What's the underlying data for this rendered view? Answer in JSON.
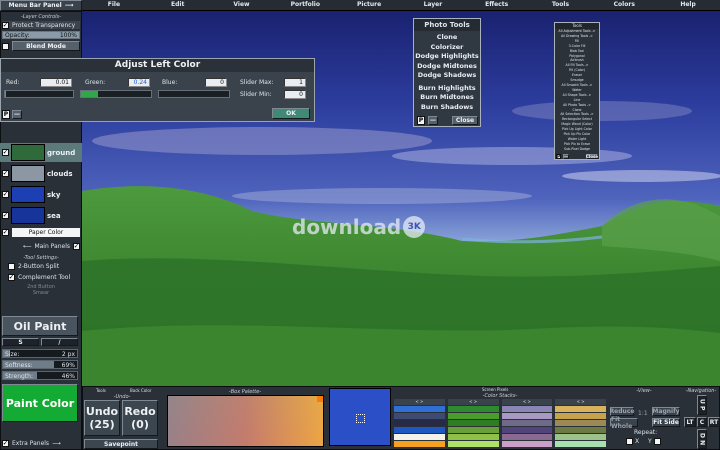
{
  "menu_bar_panel": {
    "label": "Menu Bar Panel",
    "arrow": "⟶"
  },
  "menu": {
    "items": [
      "File",
      "Edit",
      "View",
      "Portfolio",
      "Picture",
      "Layer",
      "Effects",
      "Tools",
      "Colors",
      "Help"
    ]
  },
  "layer_controls": {
    "header": "-Layer Controls-",
    "protect_label": "Protect Transparency",
    "opacity_label": "Opacity:",
    "opacity_value": "100%",
    "opacity_level": 1.0,
    "blend_label": "Blend Mode"
  },
  "adjust_color": {
    "title": "Adjust Left Color",
    "red_label": "Red:",
    "red_value": "0.01",
    "red_level": 0.01,
    "green_label": "Green:",
    "green_value": "0.24",
    "green_level": 0.24,
    "blue_label": "Blue:",
    "blue_value": "0",
    "blue_level": 0,
    "slider_max_label": "Slider Max:",
    "slider_max_value": "1",
    "slider_min_label": "Slider Min:",
    "slider_min_value": "0",
    "p_label": "P",
    "minus_label": "—",
    "ok_label": "OK"
  },
  "layers": [
    {
      "name": "ground",
      "checked": true,
      "selected": true,
      "thumb": "#2e6a3a"
    },
    {
      "name": "clouds",
      "checked": true,
      "selected": false,
      "thumb": "#8d96a3"
    },
    {
      "name": "sky",
      "checked": true,
      "selected": false,
      "thumb": "#1c3fb3"
    },
    {
      "name": "sea",
      "checked": true,
      "selected": false,
      "thumb": "#17349a"
    }
  ],
  "paper_color": {
    "label": "Paper Color"
  },
  "main_panels": {
    "label": "Main Panels",
    "arrow": "⟵"
  },
  "tool_settings": {
    "header": "-Tool Settings-",
    "split_label": "2-Button Split",
    "complement_label": "Complement Tool",
    "third_button_label": "2nd Button",
    "third_button_value": "Smear"
  },
  "tool": {
    "name": "Oil Paint",
    "option_a": "S",
    "option_b": "/"
  },
  "brush": {
    "size_label": "Size:",
    "size_value": "2 px",
    "size_level": 0.1,
    "softness_label": "Softness:",
    "softness_value": "69%",
    "softness_level": 0.69,
    "strength_label": "Strength:",
    "strength_value": "46%",
    "strength_level": 0.46
  },
  "paint_color": {
    "label": "Paint Color",
    "color": "#13ab33"
  },
  "extra_panels": {
    "label": "Extra Panels",
    "arrow": "⟶"
  },
  "photo_tools": {
    "title": "Photo Tools",
    "items": [
      "Clone",
      "Colorizer",
      "Dodge Highlights",
      "Dodge Midtones",
      "Dodge Shadows",
      "Burn Highlights",
      "Burn Midtones",
      "Burn Shadows"
    ],
    "p_label": "P",
    "minus_label": "—",
    "close_label": "Close"
  },
  "tools_list": {
    "title": "Tools",
    "items": [
      "All Adjustment Tools ->",
      "All Drawing Tools ->",
      "Fill",
      "3-Color Fill",
      "Blob Tool",
      "Polygonal",
      "Airbrush",
      "All Fill Tools ->",
      "Fill (Color)",
      "Eraser",
      "Smudge",
      "All Smooth Tools ->",
      "Water",
      "All Shape Tools ->",
      "Line",
      "All Photo Tools ->",
      "Clone",
      "All Selection Tools ->",
      "Rectangular Select",
      "Magic Wand (Color)",
      "Pick Up Light Color",
      "Pick Up Pix Color",
      "Water Light",
      "Pick Pix to Erase",
      "Sub-Pixel Dodge"
    ],
    "p_label": "P",
    "minus_label": "—",
    "close_label": "Close"
  },
  "watermark": {
    "text": "download",
    "badge": "3K"
  },
  "bottom": {
    "tools_label": "Tools",
    "back_color_label": "Back Color",
    "undo_header": "-Undo-",
    "undo_label": "Undo",
    "undo_count": "(25)",
    "redo_label": "Redo",
    "redo_count": "(0)",
    "savepoint_label": "Savepoint",
    "box_palette_header": "-Box Palette-",
    "screen_pixels_label": "Screen Pixels",
    "color_stacks_header": "-Color Stacks-",
    "stack_tabs": [
      "< >",
      "< >",
      "< >",
      "< >"
    ],
    "stacks": [
      [
        "#2f6fd6",
        "#3e4a70",
        "#262a46",
        "#1e57c2",
        "#f4f1e8",
        "#f4a020"
      ],
      [
        "#2e8a2e",
        "#4c9c2d",
        "#2e7d22",
        "#6aa03a",
        "#8ec04a",
        "#aee06a"
      ],
      [
        "#8a85b5",
        "#a799c1",
        "#6f6a8a",
        "#51447a",
        "#8a6a90",
        "#caa0c8"
      ],
      [
        "#d8b35c",
        "#c7a24c",
        "#9b8a55",
        "#6d7a45",
        "#9bc38a",
        "#a8e0b0"
      ]
    ],
    "view_header": "-View-",
    "reduce_label": "Reduce",
    "ratio_label": "1:1",
    "magnify_label": "Magnify",
    "fit_whole_label": "Fit Whole",
    "fit_side_label": "Fit Side",
    "repeat_label": "Repeat:",
    "x_label": "X",
    "y_label": "Y",
    "nav_header": "-Navigation-",
    "nav_up": "U P",
    "nav_lt": "LT",
    "nav_c": "C",
    "nav_rt": "RT",
    "nav_dn": "D N"
  }
}
